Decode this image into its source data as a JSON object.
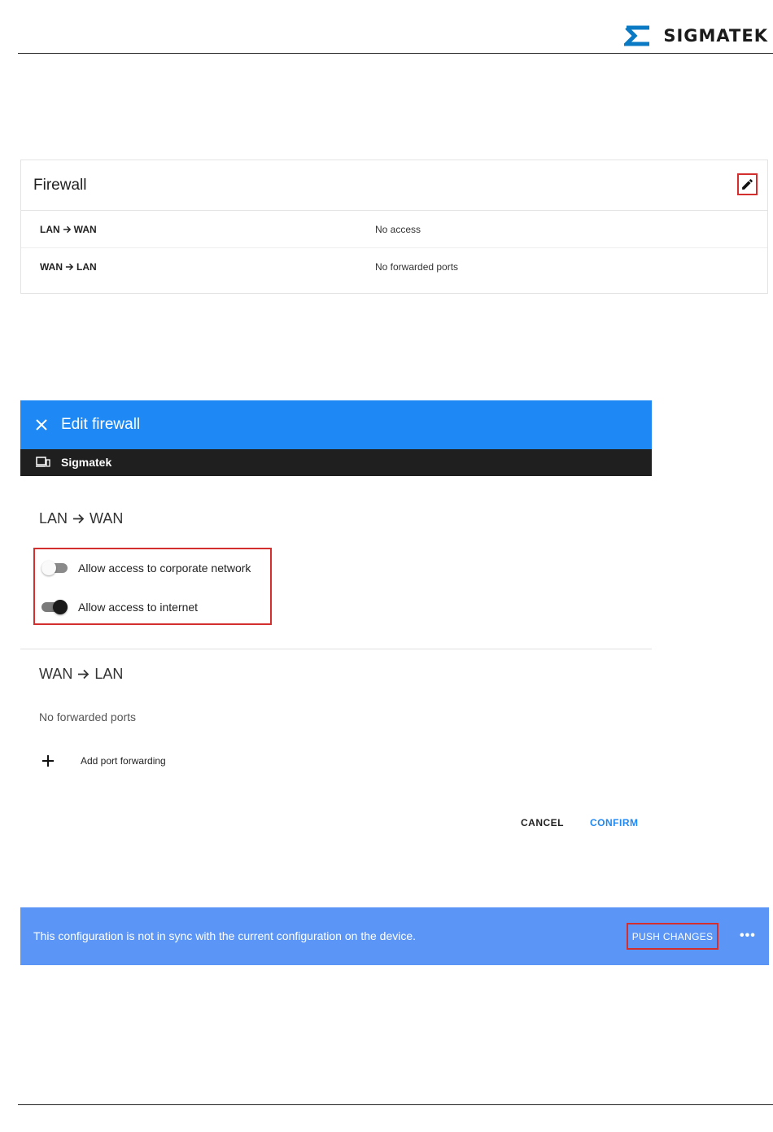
{
  "brand": {
    "name": "SIGMATEK",
    "color": "#0a7ac4"
  },
  "firewall_card": {
    "title": "Firewall",
    "edit_icon": "pencil-icon",
    "rows": [
      {
        "from": "LAN",
        "to": "WAN",
        "value": "No access"
      },
      {
        "from": "WAN",
        "to": "LAN",
        "value": "No forwarded ports"
      }
    ]
  },
  "edit_dialog": {
    "title": "Edit firewall",
    "close_icon": "close-icon",
    "device_icon": "devices-icon",
    "device_name": "Sigmatek",
    "lan_wan": {
      "from": "LAN",
      "to": "WAN",
      "toggles": [
        {
          "label": "Allow access to corporate network",
          "on": false
        },
        {
          "label": "Allow access to internet",
          "on": true
        }
      ]
    },
    "wan_lan": {
      "from": "WAN",
      "to": "LAN",
      "empty_text": "No forwarded ports",
      "add_label": "Add port forwarding"
    },
    "cancel_label": "CANCEL",
    "confirm_label": "CONFIRM",
    "accent_color": "#1e88f5"
  },
  "sync_banner": {
    "message": "This configuration is not in sync with the current configuration on the device.",
    "push_label": "PUSH CHANGES",
    "more_label": "•••",
    "background": "#5b95f5"
  }
}
